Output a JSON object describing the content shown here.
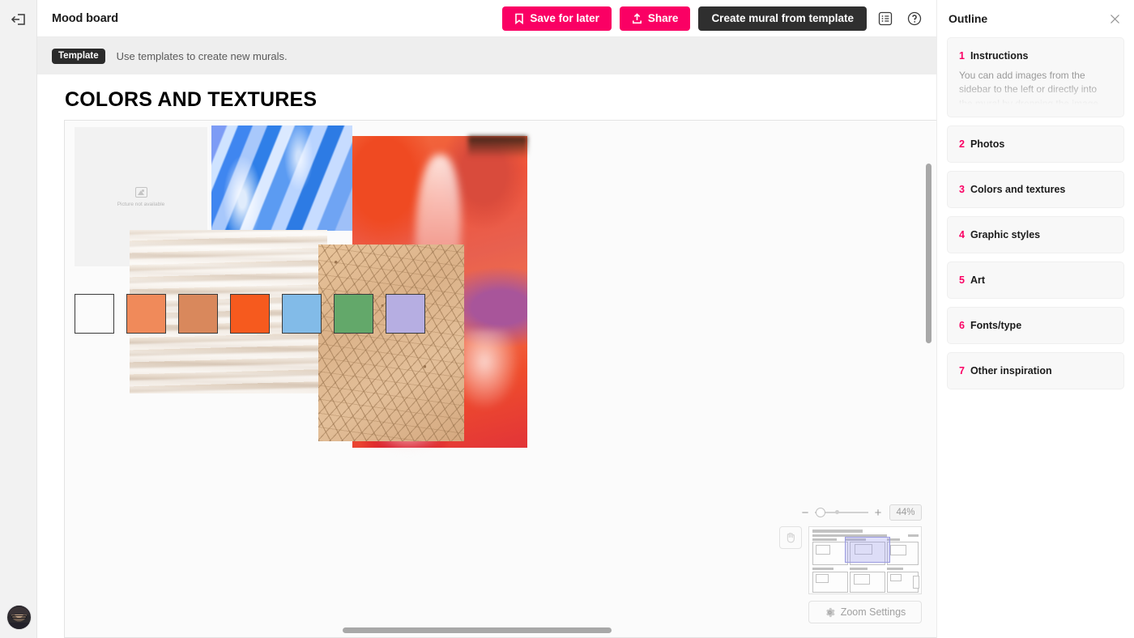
{
  "header": {
    "back_icon": "back-arrow-icon",
    "doc_title": "Mood board",
    "save_label": "Save for later",
    "save_icon": "bookmark-icon",
    "share_label": "Share",
    "share_icon": "upload-icon",
    "create_label": "Create mural from template",
    "outline_icon": "list-outline-icon",
    "help_icon": "question-mark-icon",
    "accent_color": "#fa0064",
    "dark_button_color": "#2f2f2f"
  },
  "template_bar": {
    "badge": "Template",
    "message": "Use templates to create new murals."
  },
  "canvas": {
    "board_title": "COLORS AND TEXTURES",
    "placeholder_text": "Picture not available",
    "placeholder_icon": "image-icon",
    "swatches": [
      {
        "name": "white",
        "color": "#fbfbfb"
      },
      {
        "name": "light-orange",
        "color": "#f08a5a"
      },
      {
        "name": "tan-orange",
        "color": "#d9885c"
      },
      {
        "name": "bright-orange",
        "color": "#f65a1e"
      },
      {
        "name": "light-blue",
        "color": "#82bbe8"
      },
      {
        "name": "green",
        "color": "#63a86a"
      },
      {
        "name": "light-purple",
        "color": "#b6aee2"
      }
    ]
  },
  "zoom": {
    "minus": "−",
    "plus": "+",
    "percent": "44%",
    "pan_icon": "hand-pan-icon",
    "settings_label": "Zoom Settings",
    "settings_icon": "gear-icon",
    "viewport_color": "#9a9ae0"
  },
  "outline": {
    "title": "Outline",
    "close_icon": "close-icon",
    "items": [
      {
        "num": "1",
        "label": "Instructions",
        "desc": "You can add images from the sidebar to the left or directly into the mural by dropping the image"
      },
      {
        "num": "2",
        "label": "Photos",
        "desc": ""
      },
      {
        "num": "3",
        "label": "Colors and textures",
        "desc": ""
      },
      {
        "num": "4",
        "label": "Graphic styles",
        "desc": ""
      },
      {
        "num": "5",
        "label": "Art",
        "desc": ""
      },
      {
        "num": "6",
        "label": "Fonts/type",
        "desc": ""
      },
      {
        "num": "7",
        "label": "Other inspiration",
        "desc": ""
      }
    ]
  }
}
